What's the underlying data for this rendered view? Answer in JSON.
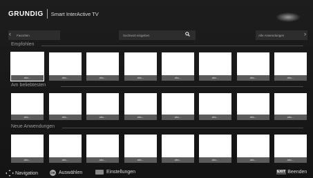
{
  "header": {
    "brand": "GRUNDIG",
    "subtitle": "Smart InterActive TV"
  },
  "topbar": {
    "favorites": "Favoriten",
    "search_placeholder": "Suchwort eingeben",
    "all_apps": "Alle Anwendungen"
  },
  "sections": [
    {
      "title": "Empfohlen",
      "tiles": [
        "abc...",
        "abc...",
        "abc...",
        "abc...",
        "abc...",
        "abc...",
        "abc...",
        "abc..."
      ]
    },
    {
      "title": "Am beliebtesten",
      "tiles": [
        "abc...",
        "abc...",
        "abc...",
        "abc...",
        "abc...",
        "abc...",
        "abc...",
        "abc..."
      ]
    },
    {
      "title": "Neue Anwendungen",
      "tiles": [
        "abc...",
        "abc...",
        "abc...",
        "abc...",
        "abc...",
        "abc...",
        "abc...",
        "abc..."
      ]
    }
  ],
  "footer": {
    "navigation": "Navigation",
    "ok_key": "OK",
    "select": "Auswählen",
    "settings": "Einstellungen",
    "exit_key": "EXIT",
    "exit": "Beenden"
  }
}
